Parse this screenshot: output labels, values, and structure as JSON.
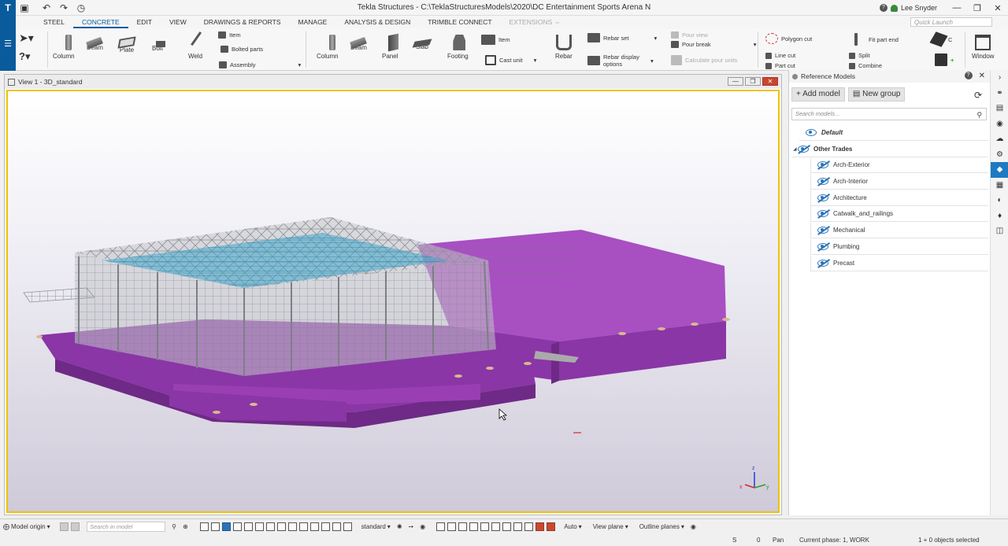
{
  "app": {
    "title": "Tekla Structures - C:\\TeklaStructuresModels\\2020\\DC Entertainment Sports Arena N",
    "user": "Lee Snyder",
    "quick_launch_placeholder": "Quick Launch"
  },
  "menu_tabs": [
    "STEEL",
    "CONCRETE",
    "EDIT",
    "VIEW",
    "DRAWINGS & REPORTS",
    "MANAGE",
    "ANALYSIS & DESIGN",
    "TRIMBLE CONNECT",
    "EXTENSIONS ⇔"
  ],
  "ribbon": {
    "steel": {
      "column": "Column",
      "beam": "Beam",
      "plate": "Plate",
      "bolt": "Bolt",
      "weld": "Weld",
      "item": "Item",
      "bolted_parts": "Bolted parts",
      "assembly": "Assembly"
    },
    "concrete": {
      "column": "Column",
      "beam": "Beam",
      "panel": "Panel",
      "slab": "Slab",
      "footing": "Footing",
      "item": "Item",
      "cast_unit": "Cast unit",
      "rebar": "Rebar",
      "rebar_set": "Rebar set",
      "rebar_display_options": "Rebar display options",
      "pour_view": "Pour view",
      "pour_break": "Pour break",
      "calculate_pour_units": "Calculate pour units"
    },
    "edit": {
      "polygon_cut": "Polygon cut",
      "line_cut": "Line cut",
      "part_cut": "Part cut",
      "fit_part_end": "Fit part end",
      "split": "Split",
      "combine": "Combine",
      "c_label": "C"
    },
    "window": "Window"
  },
  "view": {
    "title": "View 1 - 3D_standard"
  },
  "reference_models": {
    "header": "Reference Models",
    "add_model": "+ Add model",
    "new_group": "New group",
    "search_placeholder": "Search models...",
    "default_group": "Default",
    "group": "Other Trades",
    "items": [
      "Arch-Exterior",
      "Arch-Interior",
      "Architecture",
      "Catwalk_and_railings",
      "Mechanical",
      "Plumbing",
      "Precast"
    ]
  },
  "bottom_toolbar": {
    "model_origin": "Model origin",
    "search_placeholder": "Search in model",
    "standard": "standard",
    "auto": "Auto",
    "view_plane": "View plane",
    "outline_planes": "Outline planes"
  },
  "status": {
    "s_label": "S",
    "zero": "0",
    "pan": "Pan",
    "phase": "Current phase: 1, WORK",
    "selected": "1 + 0 objects selected"
  },
  "axes": {
    "x": "x",
    "y": "y",
    "z": "z"
  },
  "colors": {
    "accent": "#0a5b9c",
    "selection_border": "#f2c200",
    "concrete": "#9a3fb3",
    "steel": "#8f9296",
    "deck": "#3fa6c9"
  }
}
